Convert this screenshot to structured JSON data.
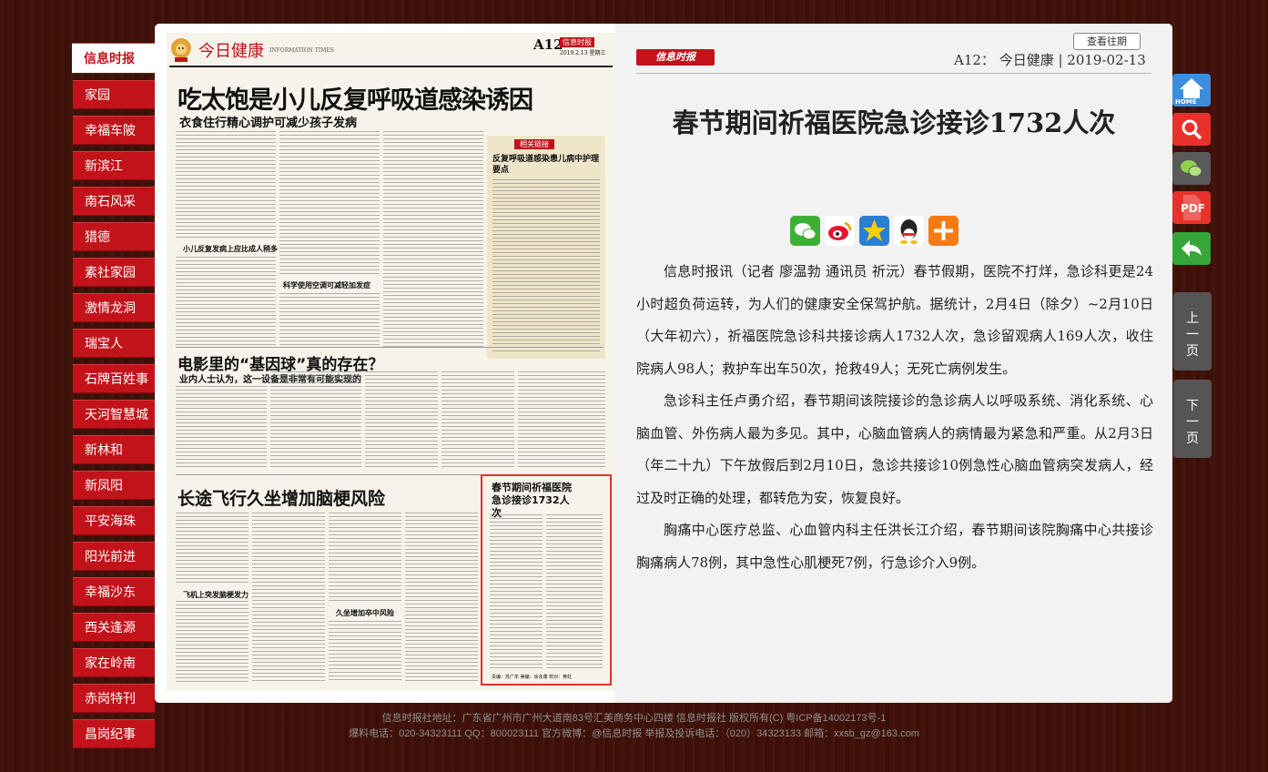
{
  "nav": {
    "items": [
      "信息时报",
      "家园",
      "幸福车陂",
      "新滨江",
      "南石风采",
      "猎德",
      "素社家园",
      "激情龙洞",
      "瑞宝人",
      "石牌百姓事",
      "天河智慧城",
      "新林和",
      "新凤阳",
      "平安海珠",
      "阳光前进",
      "幸福沙东",
      "西关逢源",
      "家在岭南",
      "赤岗特刊",
      "昌岗纪事"
    ],
    "active_index": 0
  },
  "newspaper": {
    "section": "今日健康",
    "section_en": "INFORMATION TIMES",
    "page_no": "A12",
    "brand": "信息时报",
    "date": "2019.2.13 星期三",
    "headline1": "吃太饱是小儿反复呼吸道感染诱因",
    "subhead1": "衣食住行精心调护可减少孩子发病",
    "sidebar_title": "相关链接",
    "sidebar_head": "反复呼吸道感染患儿病中护理要点",
    "headline2": "电影里的“基因球”真的存在？",
    "subhead2": "业内人士认为，这一设备是非常有可能实现的",
    "headline3": "长途飞行久坐增加脑梗风险",
    "sub3a": "飞机上突发脑梗发力",
    "sub3b": "久坐增加卒中风险",
    "boxed_title": "春节期间祈福医院急诊接诊1732人次",
    "subhead_small": "小儿反复发病上应比成人稍多",
    "subhead_small2": "科学使用空调可减轻加发症",
    "footer_credit": "责编：苏广年  美编：余永康  校对：黄虹"
  },
  "article": {
    "logo_text": "信息时报",
    "back_issue_button": "查看往期",
    "meta": "A12：  今日健康 | 2019-02-13",
    "title": "春节期间祈福医院急诊接诊1732人次",
    "paragraphs": [
      "信息时报讯（记者 廖温勃 通讯员 祈沅）春节假期，医院不打烊，急诊科更是24小时超负荷运转，为人们的健康安全保驾护航。据统计，2月4日（除夕）~2月10日（大年初六），祈福医院急诊科共接诊病人1732人次，急诊留观病人169人次，收住院病人98人；救护车出车50次，抢救49人；无死亡病例发生。",
      "急诊科主任卢勇介绍，春节期间该院接诊的急诊病人以呼吸系统、消化系统、心脑血管、外伤病人最为多见。其中，心脑血管病人的病情最为紧急和严重。从2月3日（年二十九）下午放假后到2月10日，急诊共接诊10例急性心脑血管病突发病人，经过及时正确的处理，都转危为安，恢复良好。",
      "胸痛中心医疗总监、心血管内科主任洪长江介绍，春节期间该院胸痛中心共接诊胸痛病人78例，其中急性心肌梗死7例，行急诊介入9例。"
    ],
    "share_icons": [
      "wechat-icon",
      "weibo-icon",
      "qzone-icon",
      "qq-icon",
      "more-icon"
    ]
  },
  "right_tools": {
    "home_label": "HOME",
    "pdf_label": "PDF",
    "prev_page": "上一页",
    "next_page": "下一页"
  },
  "footer": {
    "line1": "信息时报社地址：广东省广州市广州大道南83号汇美商务中心四楼     信息时报社 版权所有(C)   粤ICP备14002173号-1",
    "line2": "爆料电话：020-34323111     QQ：800023111     官方微博：@信息时报 举报及投诉电话：（020）34323133     邮箱：xxsb_gz@163.com"
  },
  "colors": {
    "nav_red": "#c2131b",
    "highlight_box": "#e0332f",
    "background": "#3a0d08"
  }
}
